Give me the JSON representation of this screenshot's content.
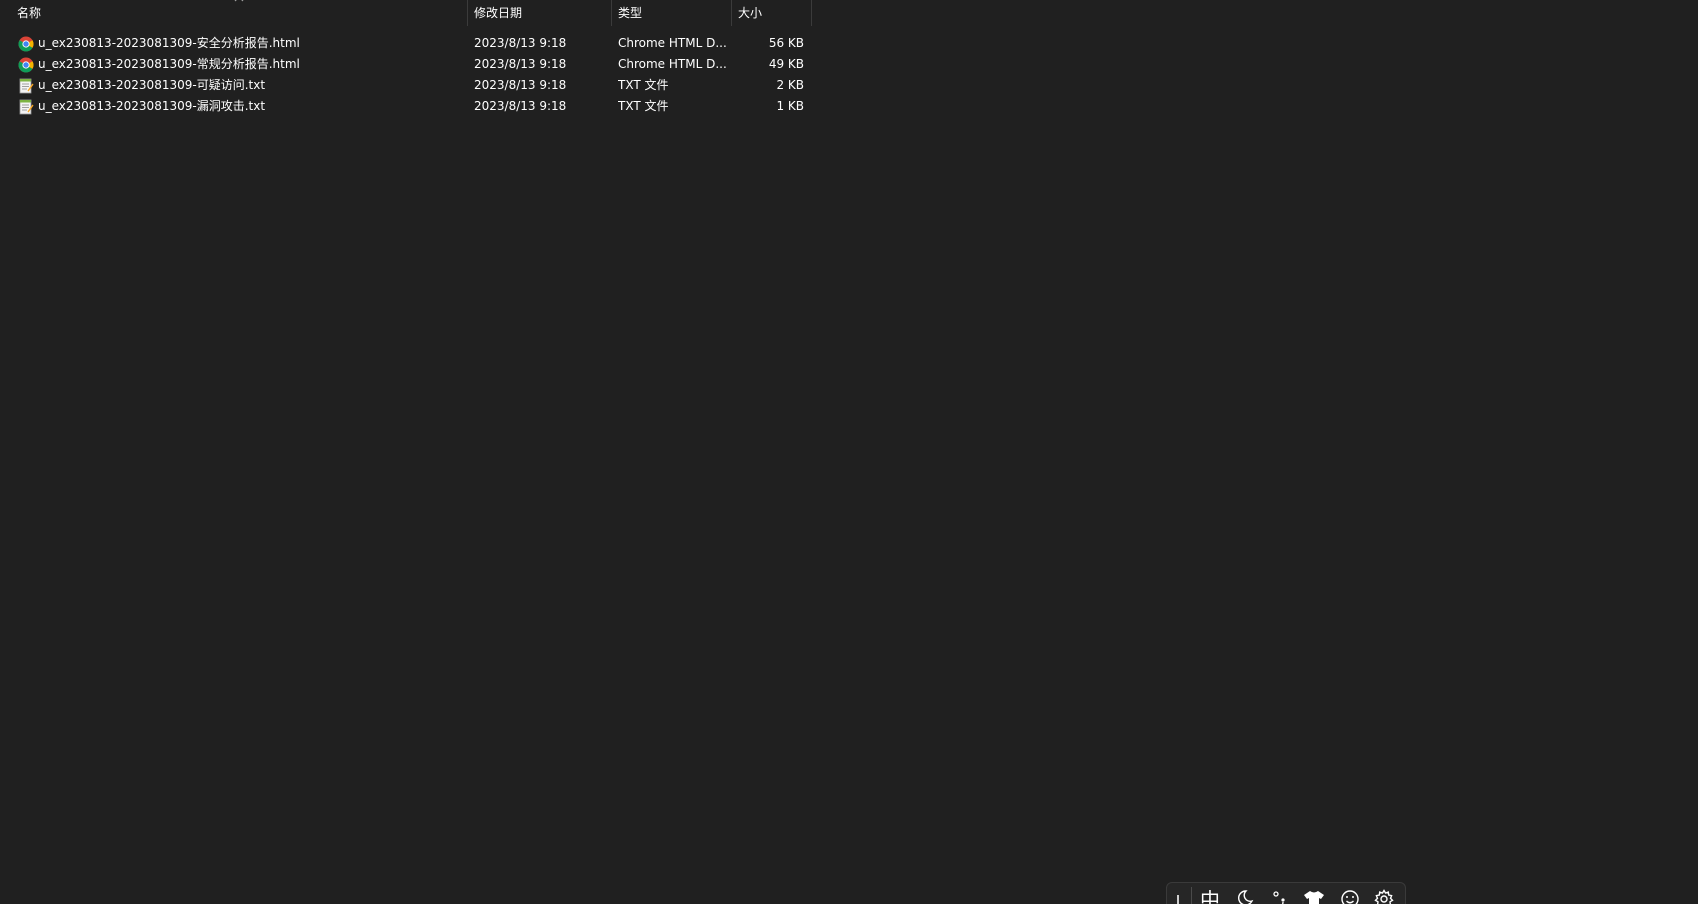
{
  "header": {
    "name": "名称",
    "date": "修改日期",
    "type": "类型",
    "size": "大小"
  },
  "files": [
    {
      "name": "u_ex230813-2023081309-安全分析报告.html",
      "date": "2023/8/13 9:18",
      "type": "Chrome HTML D...",
      "size": "56 KB",
      "icon": "chrome-icon"
    },
    {
      "name": "u_ex230813-2023081309-常规分析报告.html",
      "date": "2023/8/13 9:18",
      "type": "Chrome HTML D...",
      "size": "49 KB",
      "icon": "chrome-icon"
    },
    {
      "name": "u_ex230813-2023081309-可疑访问.txt",
      "date": "2023/8/13 9:18",
      "type": "TXT 文件",
      "size": "2 KB",
      "icon": "text-file-icon"
    },
    {
      "name": "u_ex230813-2023081309-漏洞攻击.txt",
      "date": "2023/8/13 9:18",
      "type": "TXT 文件",
      "size": "1 KB",
      "icon": "text-file-icon"
    }
  ],
  "ime": {
    "mode": "中",
    "icons": [
      "moon-icon",
      "punctuation-icon",
      "skin-icon",
      "emoji-icon",
      "gear-icon"
    ]
  },
  "colors": {
    "background": "#202020",
    "text": "#ffffff",
    "divider": "#3b3b3b"
  }
}
